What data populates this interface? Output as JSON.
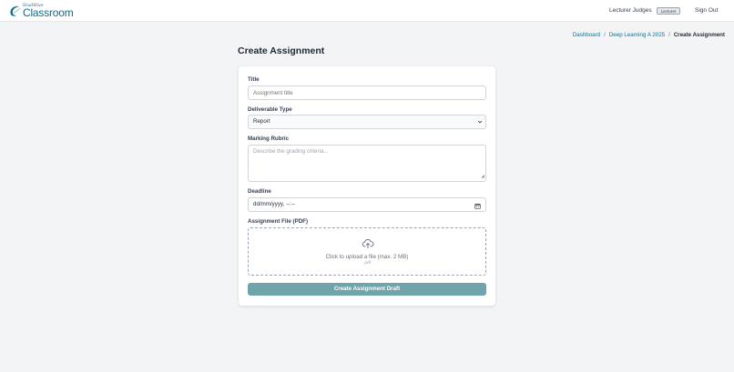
{
  "navbar": {
    "logo_tagline": "StudHive",
    "logo_name": "Classroom",
    "user_name": "Lecturer Judges",
    "role_badge": "Lecturer",
    "signout_label": "Sign Out"
  },
  "breadcrumb": {
    "items": [
      "Dashboard",
      "Deep Learning A 2025"
    ],
    "current": "Create Assignment",
    "separator": "/"
  },
  "page": {
    "title": "Create Assignment"
  },
  "form": {
    "title_label": "Title",
    "title_placeholder": "Assignment title",
    "title_value": "",
    "deliverable_label": "Deliverable Type",
    "deliverable_value": "Report",
    "rubric_label": "Marking Rubric",
    "rubric_placeholder": "Describe the grading criteria...",
    "deadline_label": "Deadline",
    "deadline_placeholder": "dd/mm/yyyy, --:--",
    "file_label": "Assignment File (PDF)",
    "upload_text": "Click to upload a file (max. 2 MB)",
    "upload_hint": ".pdf",
    "submit_label": "Create Assignment Draft"
  },
  "colors": {
    "brand": "#0e6b8a",
    "link": "#0e7490",
    "submit_bg": "#6fa4ab",
    "page_bg": "#f3f4f6"
  },
  "icons": [
    "logo-swoosh-icon",
    "chevron-down-icon",
    "calendar-icon",
    "upload-cloud-icon"
  ]
}
